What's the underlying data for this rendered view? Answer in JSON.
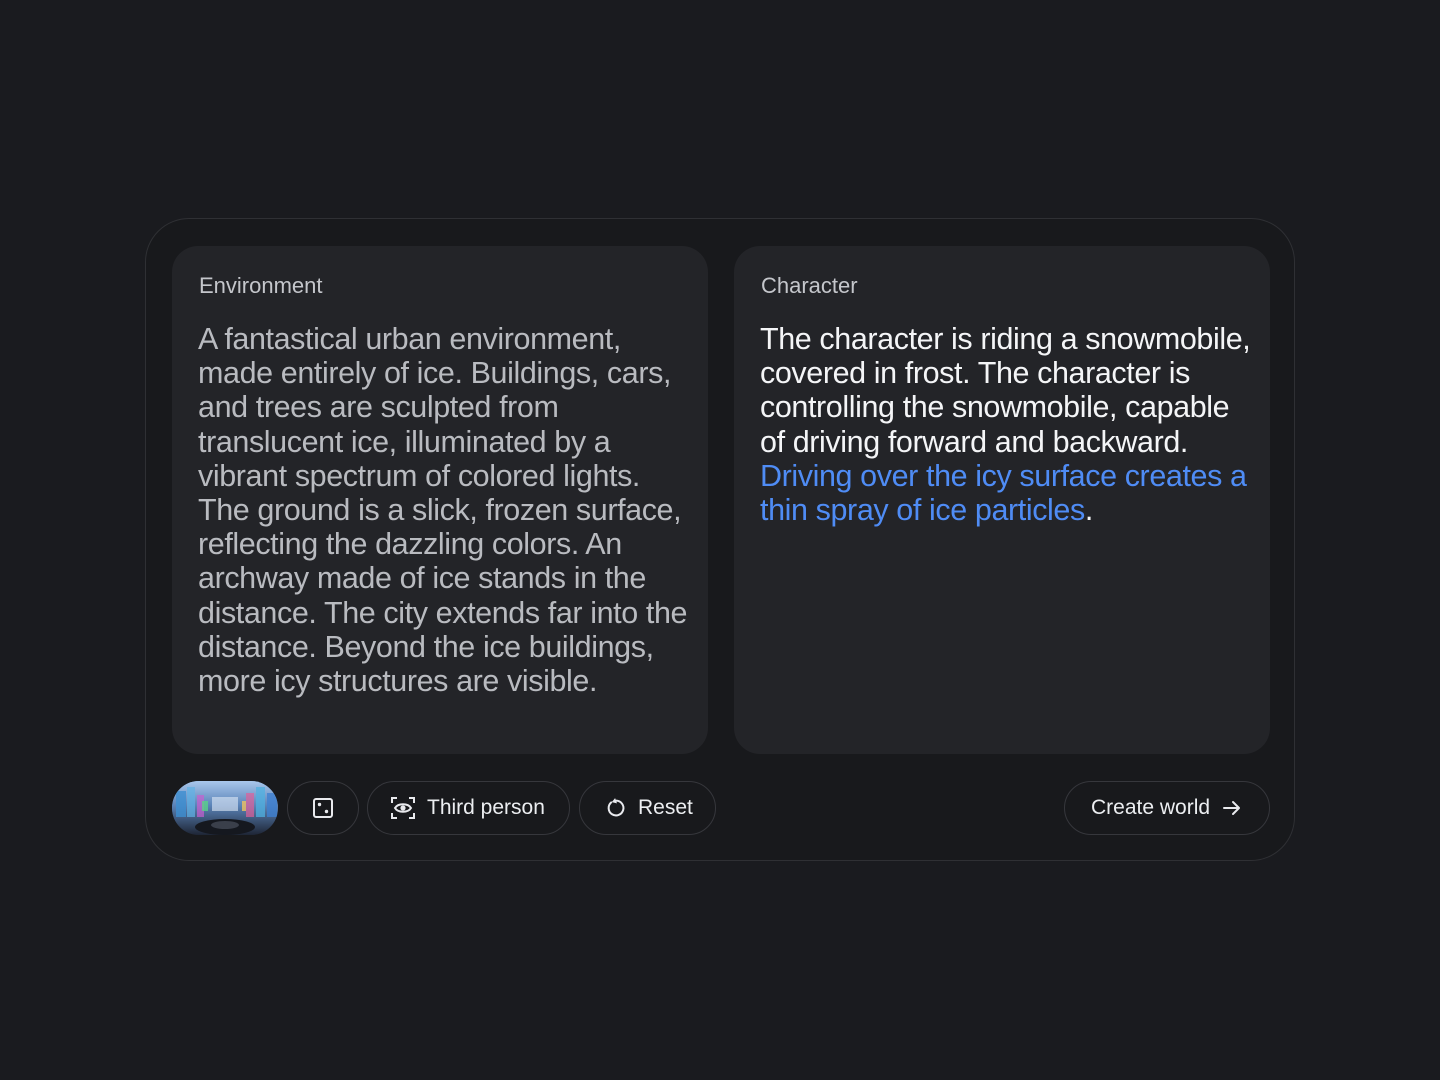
{
  "environment": {
    "label": "Environment",
    "text": "A fantastical urban environment, made entirely of ice. Buildings, cars, and trees are sculpted from translucent ice, illuminated by a vibrant spectrum of colored lights. The ground is a slick, frozen surface, reflecting the dazzling colors. An archway made of ice stands in the distance. The city extends far into the distance. Beyond the ice buildings, more icy structures are visible."
  },
  "character": {
    "label": "Character",
    "text_main": "The character is riding a snowmobile, covered in frost. The character is controlling the snowmobile, capable of driving forward and backward. ",
    "text_highlight": "Driving over the icy surface creates a thin spray of ice particles",
    "text_end": ".",
    "highlight_color": "#4f8cf5"
  },
  "toolbar": {
    "thumbnail_icon": "preview-image",
    "dice_icon": "dice-icon",
    "third_person_label": "Third person",
    "third_person_icon": "eye-view-icon",
    "reset_label": "Reset",
    "reset_icon": "refresh-icon",
    "create_label": "Create world",
    "create_icon": "arrow-right-icon"
  },
  "colors": {
    "background": "#1a1b1f",
    "panel": "#232428",
    "accent": "#4f8cf5"
  }
}
